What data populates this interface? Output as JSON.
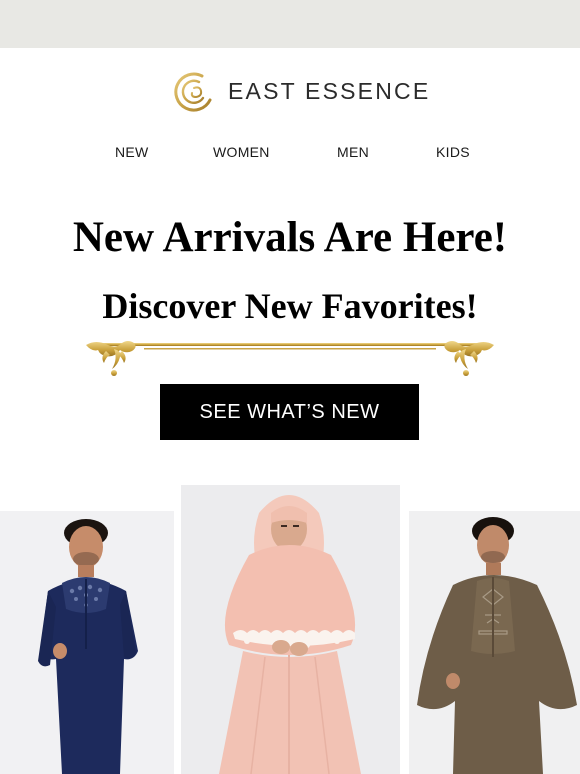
{
  "brand": {
    "name": "EAST ESSENCE",
    "logo_icon": "brand-monogram-icon",
    "accent_color": "#c9a449"
  },
  "nav": {
    "items": [
      "NEW",
      "WOMEN",
      "MEN",
      "KIDS"
    ]
  },
  "hero": {
    "headline": "New Arrivals Are Here!",
    "subheadline": "Discover New Favorites!",
    "cta_label": "SEE WHAT’S NEW",
    "divider_icon": "ornamental-divider-icon"
  },
  "products": [
    {
      "name": "navy-embroidered-thobe-photo",
      "color": "#1d2a5c"
    },
    {
      "name": "pink-lace-abaya-photo",
      "color": "#f2c2b4"
    },
    {
      "name": "brown-cape-thobe-photo",
      "color": "#6e5d48"
    }
  ]
}
